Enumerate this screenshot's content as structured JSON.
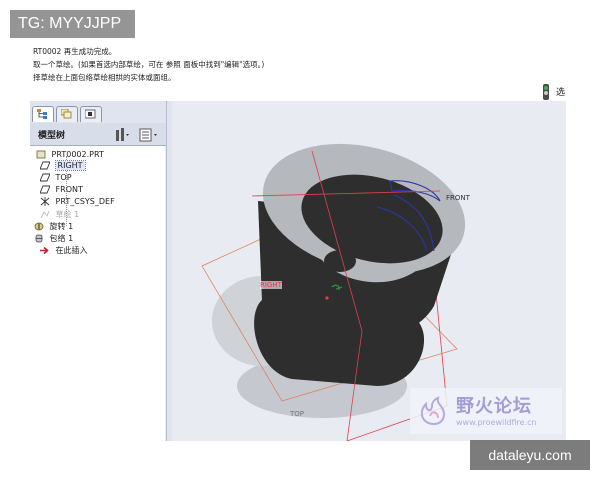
{
  "watermark_top": "TG: MYYJJPP",
  "watermark_bottom": "dataleyu.com",
  "messages": [
    "RT0002 再生成功完成。",
    "取一个草绘。(如果首选内部草绘，可在 参照 面板中找到\"编辑\"选项。)",
    "择草绘在上面包络草绘相拱的实体或面组。"
  ],
  "right_button_label": "选",
  "panel": {
    "title": "模型树",
    "tabs": [
      "model-tree-tab",
      "layer-tab",
      "folder-tab"
    ]
  },
  "tree": {
    "root": "PRT0002.PRT",
    "items": [
      {
        "label": "RIGHT",
        "icon": "datum-plane-icon",
        "selected": true
      },
      {
        "label": "TOP",
        "icon": "datum-plane-icon",
        "selected": false
      },
      {
        "label": "FRONT",
        "icon": "datum-plane-icon",
        "selected": false
      },
      {
        "label": "PRT_CSYS_DEF",
        "icon": "csys-icon",
        "selected": false
      },
      {
        "label": "草绘 1",
        "icon": "sketch-icon",
        "selected": false
      },
      {
        "label": "旋转 1",
        "icon": "revolve-icon",
        "selected": false
      },
      {
        "label": "包络 1",
        "icon": "wrap-icon",
        "selected": false
      },
      {
        "label": "在此插入",
        "icon": "insert-here-icon",
        "selected": false
      }
    ]
  },
  "viewport_labels": {
    "front": "FRONT",
    "right": "RIGHT",
    "top": "TOP"
  },
  "logo": {
    "text": "野火论坛",
    "url": "www.proewildfire.cn"
  },
  "colors": {
    "datum_red": "#e0404a",
    "datum_orange": "#ff8a3a",
    "model_dark": "#2e2e2e",
    "model_gray": "#b5b8bd",
    "wrap_blue": "#2a35a8",
    "accent_green": "#2f8a3a"
  }
}
